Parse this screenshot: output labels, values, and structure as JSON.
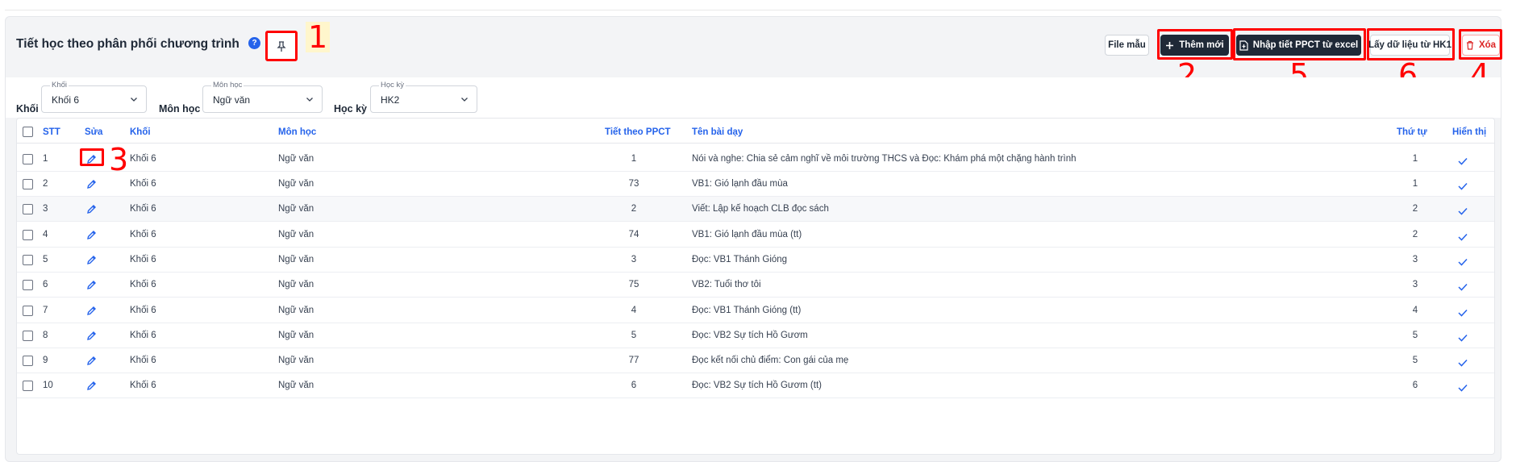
{
  "page": {
    "title": "Tiết học theo phân phối chương trình",
    "help_icon": "?"
  },
  "annotations": {
    "pin": "1",
    "add": "2",
    "edit": "3",
    "delete": "4",
    "import": "5",
    "copy": "6"
  },
  "toolbar": {
    "template_label": "File mẫu",
    "add_label": "Thêm mới",
    "import_label": "Nhập tiết PPCT từ excel",
    "copy_label": "Lấy dữ liệu từ HK1",
    "delete_label": "Xóa"
  },
  "filters": {
    "grade": {
      "label": "Khối",
      "legend": "Khối",
      "value": "Khối 6"
    },
    "subject": {
      "label": "Môn học",
      "legend": "Môn học",
      "value": "Ngữ văn"
    },
    "semester": {
      "label": "Học kỳ",
      "legend": "Học kỳ",
      "value": "HK2"
    }
  },
  "table": {
    "columns": {
      "stt": "STT",
      "edit": "Sửa",
      "grade": "Khối",
      "subject": "Môn học",
      "period": "Tiết theo PPCT",
      "lesson": "Tên bài dạy",
      "order": "Thứ tự",
      "visible": "Hiển thị"
    },
    "rows": [
      {
        "stt": "1",
        "grade": "Khối 6",
        "subject": "Ngữ văn",
        "period": "1",
        "lesson": "Nói và nghe: Chia sẻ cảm nghĩ về môi trường THCS và Đọc: Khám phá một chặng hành trình",
        "order": "1"
      },
      {
        "stt": "2",
        "grade": "Khối 6",
        "subject": "Ngữ văn",
        "period": "73",
        "lesson": "VB1: Gió lạnh đầu mùa",
        "order": "1"
      },
      {
        "stt": "3",
        "grade": "Khối 6",
        "subject": "Ngữ văn",
        "period": "2",
        "lesson": "Viết: Lập kế hoạch CLB đọc sách",
        "order": "2"
      },
      {
        "stt": "4",
        "grade": "Khối 6",
        "subject": "Ngữ văn",
        "period": "74",
        "lesson": "VB1: Gió lạnh đầu mùa (tt)",
        "order": "2"
      },
      {
        "stt": "5",
        "grade": "Khối 6",
        "subject": "Ngữ văn",
        "period": "3",
        "lesson": "Đọc: VB1 Thánh Gióng",
        "order": "3"
      },
      {
        "stt": "6",
        "grade": "Khối 6",
        "subject": "Ngữ văn",
        "period": "75",
        "lesson": "VB2: Tuổi thơ tôi",
        "order": "3"
      },
      {
        "stt": "7",
        "grade": "Khối 6",
        "subject": "Ngữ văn",
        "period": "4",
        "lesson": "Đọc: VB1 Thánh Gióng (tt)",
        "order": "4"
      },
      {
        "stt": "8",
        "grade": "Khối 6",
        "subject": "Ngữ văn",
        "period": "5",
        "lesson": "Đọc: VB2 Sự tích Hồ Gươm",
        "order": "5"
      },
      {
        "stt": "9",
        "grade": "Khối 6",
        "subject": "Ngữ văn",
        "period": "77",
        "lesson": "Đọc kết nối chủ điểm: Con gái của mẹ",
        "order": "5"
      },
      {
        "stt": "10",
        "grade": "Khối 6",
        "subject": "Ngữ văn",
        "period": "6",
        "lesson": "Đọc: VB2 Sự tích Hồ Gươm (tt)",
        "order": "6"
      }
    ]
  },
  "colors": {
    "accent": "#2563eb",
    "dark_button": "#1f2937",
    "danger": "#dc2626",
    "annotation": "#ff0000"
  }
}
